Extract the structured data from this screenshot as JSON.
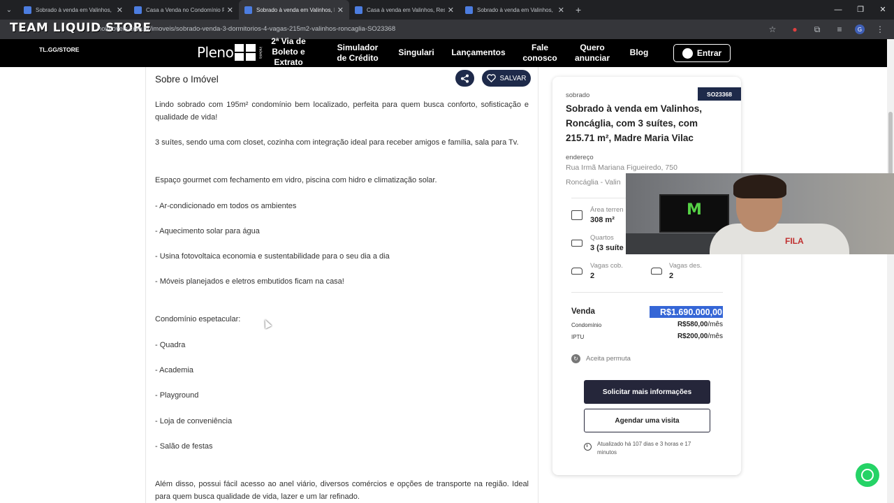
{
  "browser": {
    "tabs": [
      {
        "title": "Sobrado à venda em Valinhos,",
        "active": false
      },
      {
        "title": "Casa a Venda no Condomínio F",
        "active": false
      },
      {
        "title": "Sobrado à venda em Valinhos, I",
        "active": true
      },
      {
        "title": "Casa à venda em Valinhos, Res",
        "active": false
      },
      {
        "title": "Sobrado à venda em Valinhos, ",
        "active": false
      }
    ],
    "url": "noimoveis.com.br/imoveis/sobrado-venda-3-dormitorios-4-vagas-215m2-valinhos-roncaglia-SO23368",
    "overlay_brand": "TEAM LIQUID STORE",
    "profile_initial": "G"
  },
  "site_nav": {
    "tl_store": "TL.GG/STORE",
    "logo_text": "Pleno",
    "logo_sub": "imóveis",
    "links": [
      {
        "label": "2ª Via de\nBoleto e\nExtrato"
      },
      {
        "label": "Simulador\nde Crédito"
      },
      {
        "label": "Singulari"
      },
      {
        "label": "Lançamentos"
      },
      {
        "label": "Fale\nconosco"
      },
      {
        "label": "Quero\nanunciar"
      },
      {
        "label": "Blog"
      }
    ],
    "login_label": "Entrar"
  },
  "about": {
    "title": "Sobre o Imóvel",
    "save_label": "SALVAR",
    "paragraphs": [
      "Lindo sobrado com 195m² condomínio bem localizado, perfeita para quem busca conforto, sofisticação e qualidade de vida!",
      "3 suítes, sendo uma com closet, cozinha com integração ideal para receber amigos e família, sala para Tv.",
      "Espaço gourmet com fechamento em vidro, piscina com hidro e climatização solar.",
      "- Ar-condicionado em todos os ambientes",
      "- Aquecimento solar para água",
      "- Usina fotovoltaica economia e sustentabilidade para o seu dia a dia",
      "- Móveis planejados e eletros embutidos ficam na casa!",
      "Condomínio espetacular:",
      "- Quadra",
      "- Academia",
      "- Playground",
      "- Loja de conveniência",
      "- Salão de festas",
      "Além disso, possui fácil acesso ao anel viário, diversos comércios e opções de transporte na região. Ideal para quem busca qualidade de vida, lazer e um lar refinado."
    ]
  },
  "card": {
    "code": "SO23368",
    "type": "sobrado",
    "title": "Sobrado à venda em Valinhos, Roncáglia, com 3 suítes, com 215.71 m², Madre Maria Vilac",
    "address_label": "endereço",
    "address_line1": "Rua Irmã Mariana Figueiredo, 750",
    "address_line2": "Roncáglia - Valin",
    "features": {
      "area_label": "Área terren",
      "area_value": "308 m²",
      "rooms_label": "Quartos",
      "rooms_value": "3 (3 suíte",
      "covered_label": "Vagas cob.",
      "covered_value": "2",
      "uncovered_label": "Vagas des.",
      "uncovered_value": "2"
    },
    "sale_label": "Venda",
    "sale_price": "R$1.690.000,00",
    "condo_label": "Condomínio",
    "condo_amount": "R$580,00",
    "iptu_label": "IPTU",
    "iptu_amount": "R$200,00",
    "per_month": "/mês",
    "permuta": "Aceita permuta",
    "request_info": "Solicitar mais informações",
    "schedule_visit": "Agendar uma visita",
    "updated": "Atualizado há 107 dias e 3 horas e 17 minutos"
  },
  "webcam": {
    "monitor_brand": "MONSTER",
    "shirt_brand": "FILA"
  },
  "colors": {
    "nav_bg": "#000000",
    "accent_dark": "#1e2a4a",
    "price_highlight": "#3566d6",
    "whatsapp": "#25d366"
  }
}
